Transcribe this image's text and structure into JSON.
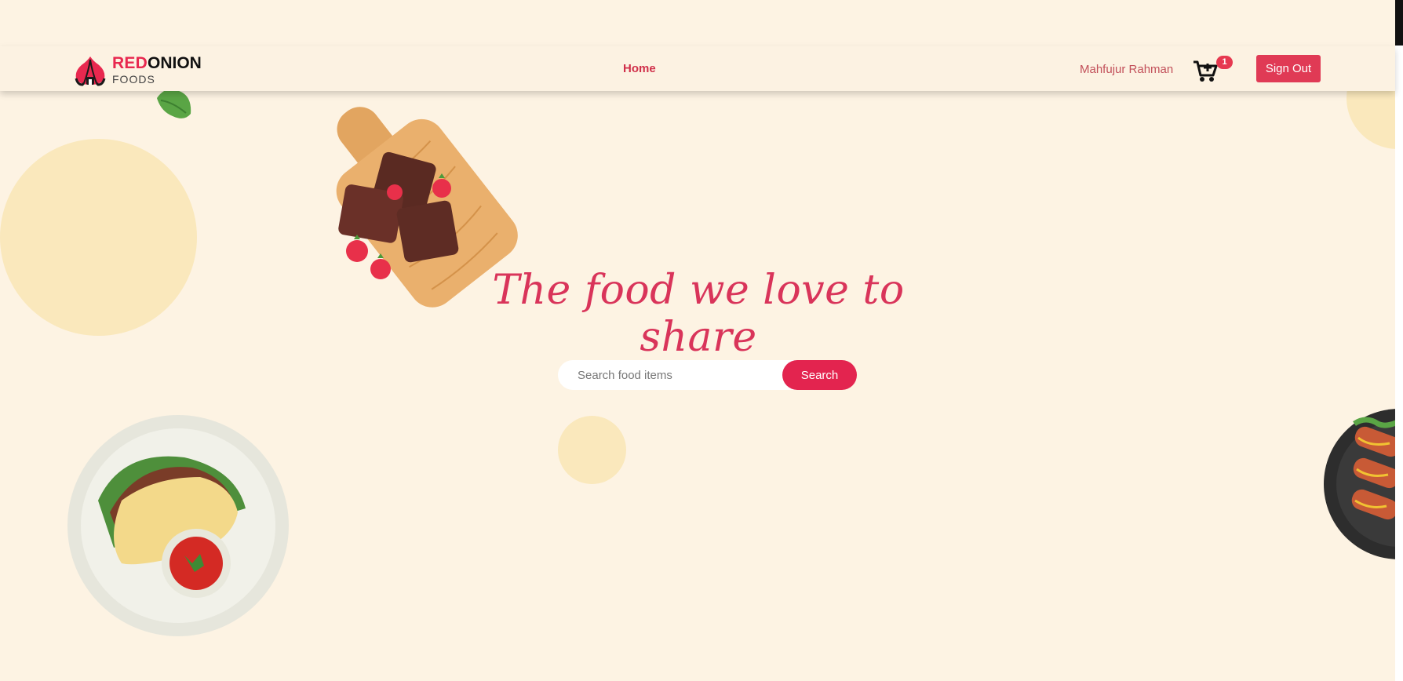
{
  "brand": {
    "name_red": "RED",
    "name_black": "ONION",
    "subtitle": "FOODS",
    "accent_color": "#e8284f"
  },
  "nav": {
    "home_label": "Home",
    "user_name": "Mahfujur Rahman",
    "cart_icon": "cart-plus-icon",
    "cart_count": "1",
    "signout_label": "Sign Out"
  },
  "hero": {
    "title": "The food we love to share",
    "search_placeholder": "Search food items",
    "search_button": "Search"
  },
  "colors": {
    "background": "#fdf3e3",
    "primary": "#e3244f",
    "decor_circle": "#fae8bc"
  }
}
